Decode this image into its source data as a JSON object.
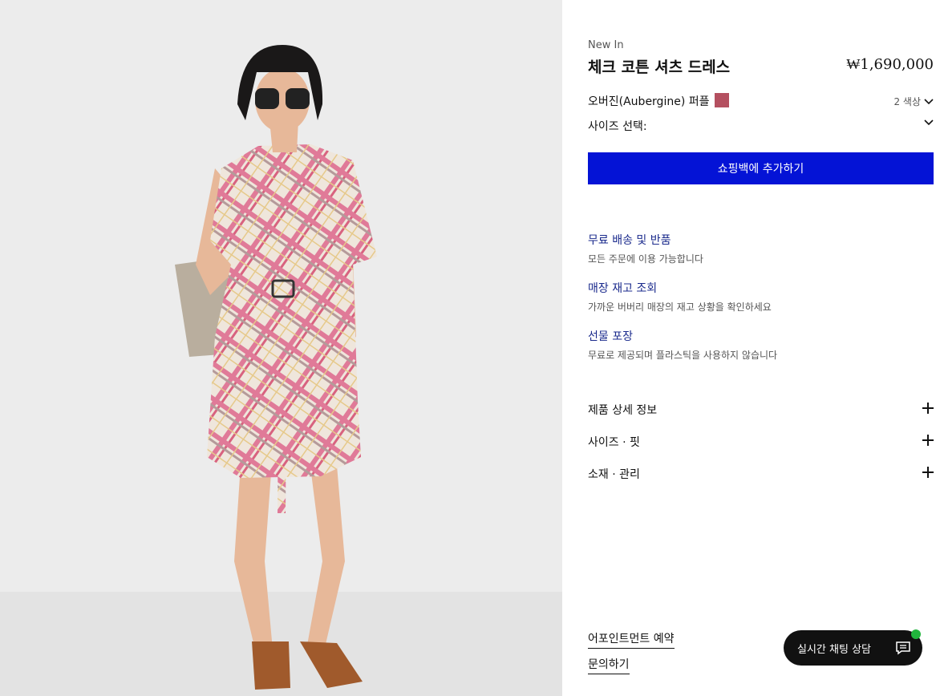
{
  "product": {
    "eyebrow": "New In",
    "title": "체크 코튼 셔츠 드레스",
    "price": "₩1,690,000",
    "color_label": "오버진(Aubergine) 퍼플",
    "color_swatch": "#b45060",
    "color_count": "2 색상",
    "size_label": "사이즈 선택:",
    "add_to_bag": "쇼핑백에 추가하기"
  },
  "services": [
    {
      "title": "무료 배송 및 반품",
      "desc": "모든 주문에 이용 가능합니다"
    },
    {
      "title": "매장 재고 조회",
      "desc": "가까운 버버리 매장의 재고 상황을 확인하세요"
    },
    {
      "title": "선물 포장",
      "desc": "무료로 제공되며 플라스틱을 사용하지 않습니다"
    }
  ],
  "accordions": [
    "제품 상세 정보",
    "사이즈 · 핏",
    "소재 · 관리"
  ],
  "links": {
    "appointment": "어포인트먼트 예약",
    "inquiry": "문의하기"
  },
  "chat": {
    "label": "실시간 채팅 상담",
    "icon": "chat-icon",
    "status_color": "#21b53d"
  },
  "colors": {
    "accent": "#0413d6",
    "link": "#1a2a8c"
  }
}
